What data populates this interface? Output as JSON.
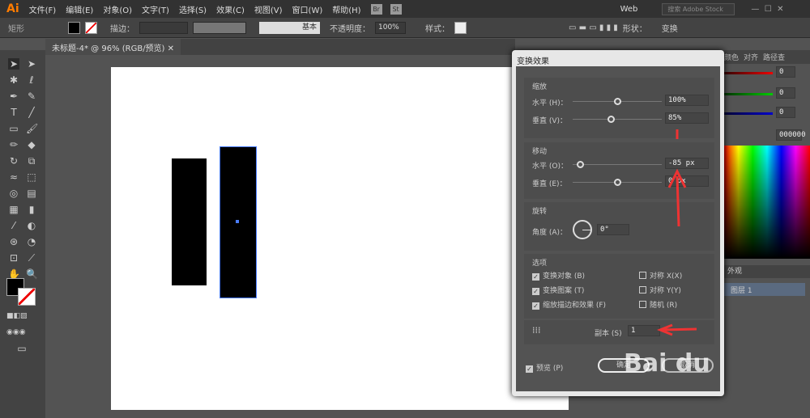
{
  "app": {
    "logo": "Ai",
    "menus": [
      "文件(F)",
      "编辑(E)",
      "对象(O)",
      "文字(T)",
      "选择(S)",
      "效果(C)",
      "视图(V)",
      "窗口(W)",
      "帮助(H)"
    ],
    "bridge": "Br",
    "stock": "St",
    "workspace": "Web",
    "search_placeholder": "搜索 Adobe Stock"
  },
  "control": {
    "object_type": "矩形",
    "stroke_label": "描边：",
    "stroke_style": "基本",
    "opacity_label": "不透明度：",
    "opacity": "100%",
    "style_label": "样式：",
    "shape_label": "形状：",
    "transform_label": "变换"
  },
  "document": {
    "tab": "未标题-4* @ 96% (RGB/预览)"
  },
  "dialog": {
    "title": "变换效果",
    "scale": {
      "heading": "缩放",
      "h_label": "水平 (H)：",
      "h_value": "100%",
      "h_pct": 50,
      "v_label": "垂直 (V)：",
      "v_value": "85%",
      "v_pct": 43
    },
    "move": {
      "heading": "移动",
      "h_label": "水平 (O)：",
      "h_value": "-85 px",
      "h_pct": 8,
      "v_label": "垂直 (E)：",
      "v_value": "0 px",
      "v_pct": 50
    },
    "rotate": {
      "heading": "旋转",
      "angle_label": "角度 (A)：",
      "angle_value": "0°"
    },
    "options": {
      "heading": "选项",
      "items": [
        {
          "label": "变换对象 (B)",
          "checked": true
        },
        {
          "label": "变换图案 (T)",
          "checked": true
        },
        {
          "label": "缩放描边和效果 (F)",
          "checked": true
        },
        {
          "label": "对称 X(X)",
          "checked": false
        },
        {
          "label": "对称 Y(Y)",
          "checked": false
        },
        {
          "label": "随机 (R)",
          "checked": false
        }
      ]
    },
    "copies_label": "副本 (S)",
    "copies_value": "1",
    "preview_label": "预览 (P)",
    "ok": "确定",
    "cancel": "取消"
  },
  "right_panel": {
    "tabs": [
      "颜色",
      "对齐",
      "路径查"
    ],
    "r": "0",
    "g": "0",
    "b": "0",
    "hex": "000000",
    "layers_tab": "外观",
    "layer_name": "图层 1"
  },
  "watermark": "Bai du"
}
